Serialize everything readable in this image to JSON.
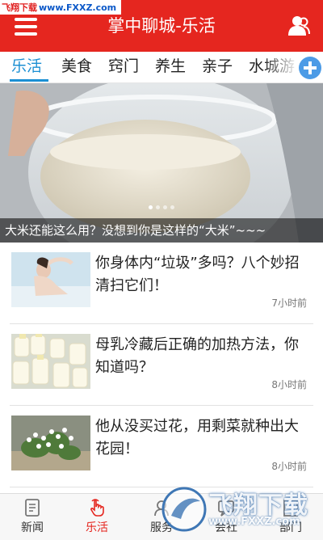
{
  "watermark": {
    "site_a": "飞翔下载",
    "site_b": "www.FXXZ.com"
  },
  "header": {
    "title": "掌中聊城-乐活"
  },
  "tabs": [
    {
      "label": "乐活",
      "active": true
    },
    {
      "label": "美食",
      "active": false
    },
    {
      "label": "窍门",
      "active": false
    },
    {
      "label": "养生",
      "active": false
    },
    {
      "label": "亲子",
      "active": false
    },
    {
      "label": "水城游",
      "active": false
    }
  ],
  "banner": {
    "caption": "大米还能这么用？没想到你是这样的“大米”~~~",
    "slide_count": 4,
    "active_slide": 1
  },
  "news": [
    {
      "title": "你身体内“垃圾”多吗？八个妙招清扫它们！",
      "time": "7小时前",
      "thumb": "bath-photo"
    },
    {
      "title": "母乳冷藏后正确的加热方法，你知道吗？",
      "time": "8小时前",
      "thumb": "milk-bottles-photo"
    },
    {
      "title": "他从没买过花，用剩菜就种出大花园！",
      "time": "8小时前",
      "thumb": "flowers-photo"
    }
  ],
  "bottom_nav": [
    {
      "label": "新闻",
      "icon": "news-doc-icon",
      "active": false
    },
    {
      "label": "乐活",
      "icon": "tap-finger-icon",
      "active": true
    },
    {
      "label": "服务",
      "icon": "service-icon",
      "active": false
    },
    {
      "label": "会社",
      "icon": "community-icon",
      "active": false
    },
    {
      "label": "部门",
      "icon": "department-icon",
      "active": false
    }
  ],
  "watermark_br": {
    "logo": "飞翔下载",
    "url": "www.FXXZ.com"
  },
  "colors": {
    "brand_red": "#e5261f",
    "tab_active": "#1b8fd3"
  }
}
